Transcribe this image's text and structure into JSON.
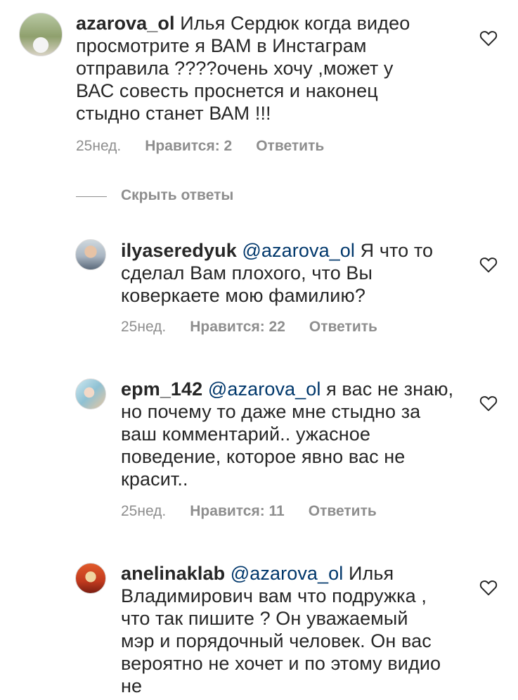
{
  "comments": [
    {
      "username": "azarova_ol",
      "mention": "",
      "text": "Илья Сердюк когда видео просмотрите я ВАМ в Инстаграм отправила ????очень хочу ,может у ВАС совесть проснется и наконец стыдно станет ВАМ !!!",
      "time": "25нед.",
      "likes": "Нравится: 2",
      "reply": "Ответить"
    },
    {
      "username": "ilyaseredyuk",
      "mention": "@azarova_ol",
      "text": "Я что то сделал Вам плохого, что Вы коверкаете мою фамилию?",
      "time": "25нед.",
      "likes": "Нравится: 22",
      "reply": "Ответить"
    },
    {
      "username": "epm_142",
      "mention": "@azarova_ol",
      "text": " я вас не знаю, но почему то даже мне стыдно за ваш комментарий.. ужасное поведение, которое явно вас не красит..",
      "time": "25нед.",
      "likes": "Нравится: 11",
      "reply": "Ответить"
    },
    {
      "username": "anelinaklab",
      "mention": "@azarova_ol",
      "text": "Илья Владимирович вам что подружка , что так пишите ? Он уважаемый мэр и порядочный человек. Он вас вероятно не хочет и по этому видио не",
      "time": "",
      "likes": "",
      "reply": ""
    }
  ],
  "hide_replies": "Скрыть ответы",
  "icons": {
    "avatar": "avatar-photo",
    "like": "heart-outline-icon"
  },
  "colors": {
    "text": "#262626",
    "meta": "#8e8e8e",
    "mention": "#00376b"
  }
}
